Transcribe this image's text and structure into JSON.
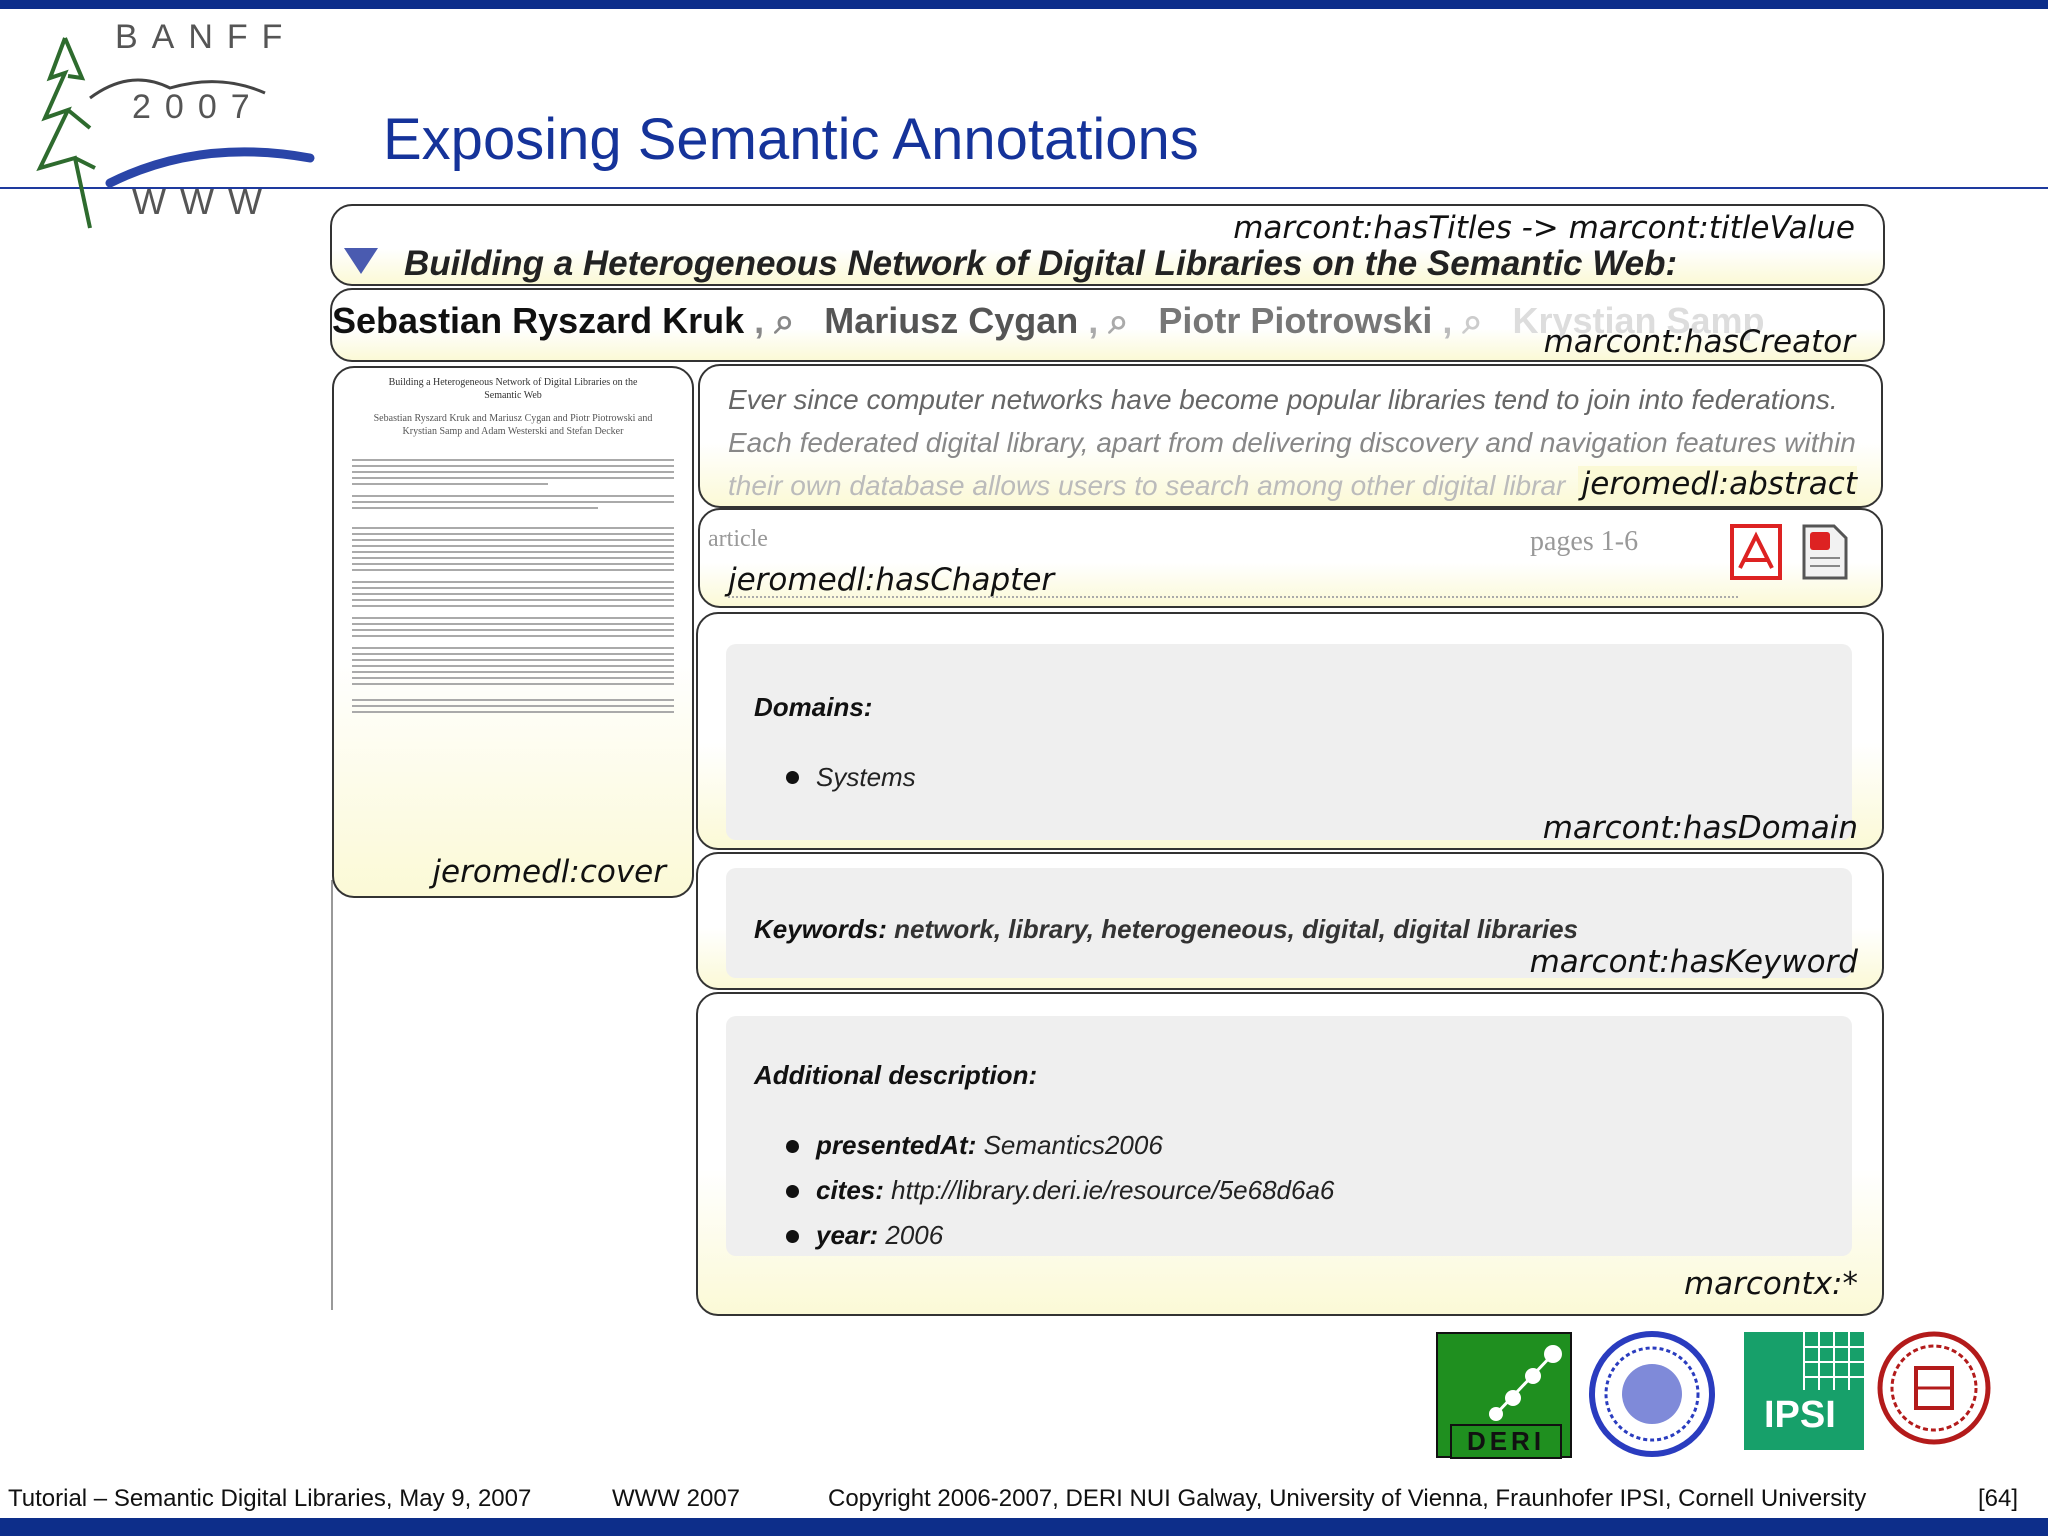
{
  "slide": {
    "title": "Exposing Semantic Annotations",
    "footer": {
      "left": "Tutorial – Semantic Digital Libraries, May 9, 2007",
      "center": "WWW 2007",
      "right": "Copyright 2006-2007, DERI NUI Galway, University of Vienna, Fraunhofer IPSI, Cornell University",
      "page": "[64]"
    }
  },
  "logo": {
    "line1": "BANFF",
    "line2": "2007",
    "line3": "WWW"
  },
  "record": {
    "title_property": "marcont:hasTitles -> marcont:titleValue",
    "title": "Building a Heterogeneous Network of Digital Libraries on the Semantic Web:",
    "creator_property": "marcont:hasCreator",
    "authors": [
      "Sebastian Ryszard Kruk",
      "Mariusz Cygan",
      "Piotr Piotrowski",
      "Krystian Samp"
    ],
    "author_separator": ",",
    "abstract_lines": [
      "Ever since computer networks have become popular libraries tend to join into federations.",
      "Each federated digital library, apart from delivering discovery and navigation features within",
      "their own database allows users to search among other digital librar"
    ],
    "abstract_property": "jeromedl:abstract",
    "article_label": "article",
    "pages_label": "pages 1-6",
    "chapter_property": "jeromedl:hasChapter",
    "cover_property": "jeromedl:cover",
    "cover_title": "Building a Heterogeneous Network of Digital Libraries on the Semantic Web",
    "cover_authors": "Sebastian Ryszard Kruk and Mariusz Cygan and Piotr Piotrowski and Krystian Samp and Adam Westerski and Stefan Decker",
    "domains_heading": "Domains:",
    "domains": [
      "Systems"
    ],
    "domain_property": "marcont:hasDomain",
    "keywords_heading": "Keywords:",
    "keywords": "network, library, heterogeneous, digital, digital libraries",
    "keyword_property": "marcont:hasKeyword",
    "additional_heading": "Additional description:",
    "additional": [
      {
        "key": "presentedAt:",
        "value": "Semantics2006"
      },
      {
        "key": "cites:",
        "value": "http://library.deri.ie/resource/5e68d6a6"
      },
      {
        "key": "year:",
        "value": "2006"
      }
    ],
    "additional_property": "marcontx:*"
  },
  "partner_logos": [
    {
      "name": "DERI",
      "label": "DERI",
      "color": "#1f8f1f"
    },
    {
      "name": "University of Vienna",
      "label": "",
      "color": "#2a3cbf"
    },
    {
      "name": "Fraunhofer IPSI",
      "label": "IPSI",
      "color": "#17a06a"
    },
    {
      "name": "Cornell University",
      "label": "",
      "color": "#b31b1b"
    }
  ]
}
